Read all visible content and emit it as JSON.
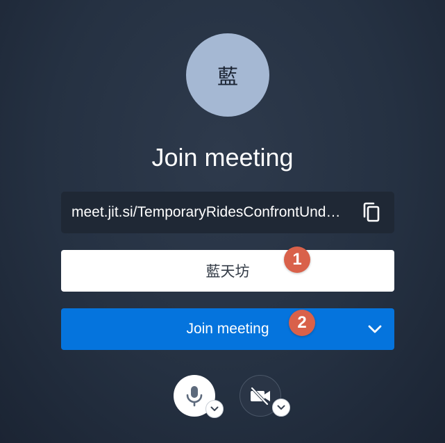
{
  "avatar": {
    "initial": "藍"
  },
  "title": "Join meeting",
  "meeting_url": "meet.jit.si/TemporaryRidesConfrontUnderneath",
  "display_name": {
    "value": "藍天坊"
  },
  "join_button": {
    "label": "Join meeting"
  },
  "annotations": [
    "1",
    "2"
  ],
  "icons": {
    "copy": "copy-icon",
    "join_dropdown": "chevron-down-icon",
    "mic": "microphone-icon",
    "camera": "camera-off-icon"
  },
  "colors": {
    "background": "#253142",
    "avatar": "#a5b8d3",
    "url_box": "#1f2835",
    "join_button": "#0574dd",
    "badge": "#d9614a"
  }
}
